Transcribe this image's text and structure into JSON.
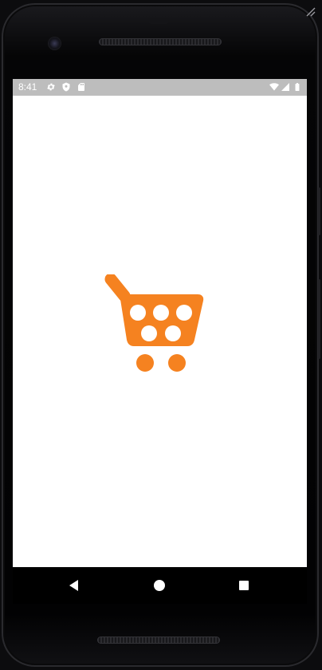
{
  "status_bar": {
    "time": "8:41",
    "icons_left": [
      "settings-gear-icon",
      "shield-icon",
      "sd-card-icon"
    ],
    "icons_right": [
      "wifi-icon",
      "cell-signal-icon",
      "battery-icon"
    ],
    "background_color": "#bdbdbd"
  },
  "app": {
    "splash_icon": "shopping-cart-icon",
    "brand_color": "#f58220",
    "background_color": "#ffffff"
  },
  "nav_bar": {
    "buttons": [
      "back-triangle-icon",
      "home-circle-icon",
      "recents-square-icon"
    ]
  }
}
